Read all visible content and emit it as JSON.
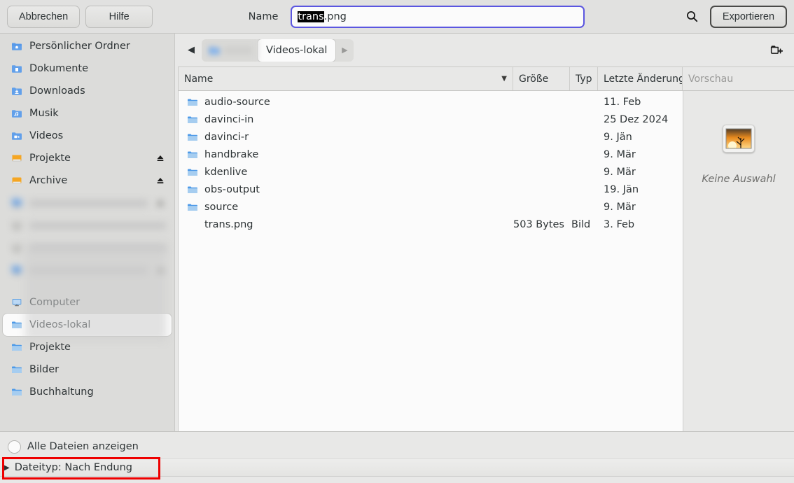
{
  "window": {
    "title": "Exportieren"
  },
  "header": {
    "cancel_label": "Abbrechen",
    "help_label": "Hilfe",
    "name_label": "Name",
    "filename_selected": "trans",
    "filename_rest": ".png",
    "filename_full": "trans.png",
    "search_icon": "search-icon",
    "export_label": "Exportieren",
    "accent_focus_color": "#5b56e0"
  },
  "pathbar": {
    "back_icon": "triangle-left-icon",
    "forward_icon": "triangle-right-icon",
    "crumbs": [
      {
        "label": "",
        "icon": "home-folder-icon",
        "redacted": true,
        "active": false
      },
      {
        "label": "Videos-lokal",
        "icon": "",
        "redacted": false,
        "active": true
      }
    ],
    "new_folder_icon": "new-folder-icon"
  },
  "sidebar": {
    "items": [
      {
        "label": "Persönlicher Ordner",
        "icon": "home-folder-icon",
        "eject": false,
        "selected": false,
        "blurred": false
      },
      {
        "label": "Dokumente",
        "icon": "documents-folder-icon",
        "eject": false,
        "selected": false,
        "blurred": false
      },
      {
        "label": "Downloads",
        "icon": "downloads-folder-icon",
        "eject": false,
        "selected": false,
        "blurred": false
      },
      {
        "label": "Musik",
        "icon": "music-folder-icon",
        "eject": false,
        "selected": false,
        "blurred": false
      },
      {
        "label": "Videos",
        "icon": "videos-folder-icon",
        "eject": false,
        "selected": false,
        "blurred": false
      },
      {
        "label": "Projekte",
        "icon": "drive-icon",
        "eject": true,
        "selected": false,
        "blurred": false
      },
      {
        "label": "Archive",
        "icon": "drive-icon",
        "eject": true,
        "selected": false,
        "blurred": false
      },
      {
        "label": "",
        "icon": "network-folder-icon",
        "eject": true,
        "selected": false,
        "blurred": true
      },
      {
        "label": "",
        "icon": "network-drive-icon",
        "eject": false,
        "selected": false,
        "blurred": true
      },
      {
        "label": "",
        "icon": "network-drive-icon",
        "eject": false,
        "selected": false,
        "blurred": true
      },
      {
        "label": "",
        "icon": "network-folder-icon",
        "eject": true,
        "selected": false,
        "blurred": true
      },
      {
        "label": "Computer",
        "icon": "computer-icon",
        "eject": false,
        "selected": false,
        "blurred": false
      },
      {
        "label": "Videos-lokal",
        "icon": "bookmark-folder-icon",
        "eject": false,
        "selected": true,
        "blurred": false
      },
      {
        "label": "Projekte",
        "icon": "bookmark-folder-icon",
        "eject": false,
        "selected": false,
        "blurred": false
      },
      {
        "label": "Bilder",
        "icon": "bookmark-folder-icon",
        "eject": false,
        "selected": false,
        "blurred": false
      },
      {
        "label": "Buchhaltung",
        "icon": "bookmark-folder-icon",
        "eject": false,
        "selected": false,
        "blurred": false
      }
    ],
    "selection_left_color": "#6a5ae0",
    "selection_right_color": "#cc4ad0"
  },
  "filelist": {
    "columns": {
      "name": "Name",
      "size": "Größe",
      "type": "Typ",
      "modified": "Letzte Änderung",
      "preview": "Vorschau"
    },
    "sort_icon": "sort-descending-icon",
    "rows": [
      {
        "name": "audio-source",
        "size": "",
        "type": "",
        "modified": "11. Feb",
        "icon": "folder-icon"
      },
      {
        "name": "davinci-in",
        "size": "",
        "type": "",
        "modified": "25 Dez 2024",
        "icon": "folder-icon"
      },
      {
        "name": "davinci-r",
        "size": "",
        "type": "",
        "modified": "9. Jän",
        "icon": "folder-icon"
      },
      {
        "name": "handbrake",
        "size": "",
        "type": "",
        "modified": "9. Mär",
        "icon": "folder-icon"
      },
      {
        "name": "kdenlive",
        "size": "",
        "type": "",
        "modified": "9. Mär",
        "icon": "folder-icon"
      },
      {
        "name": "obs-output",
        "size": "",
        "type": "",
        "modified": "19. Jän",
        "icon": "folder-icon"
      },
      {
        "name": "source",
        "size": "",
        "type": "",
        "modified": "9. Mär",
        "icon": "folder-icon"
      },
      {
        "name": "trans.png",
        "size": "503 Bytes",
        "type": "Bild",
        "modified": "3. Feb",
        "icon": "transparent-image-icon"
      }
    ]
  },
  "preview": {
    "placeholder_icon": "image-placeholder-icon",
    "empty_label": "Keine Auswahl"
  },
  "footer": {
    "show_all_label": "Alle Dateien anzeigen",
    "show_all_checked": false,
    "filetype_label": "Dateityp: Nach Endung",
    "expander_icon": "triangle-right-icon",
    "highlight_color": "#ee0000"
  }
}
